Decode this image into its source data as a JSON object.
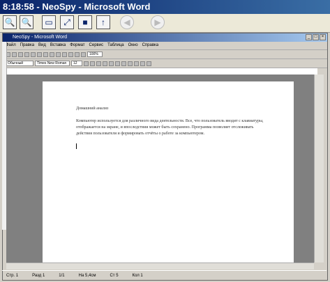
{
  "outer_window": {
    "title": "8:18:58 - NeoSpy - Microsoft Word"
  },
  "viewer_toolbar": {
    "buttons": [
      {
        "icon": "zoom-in-icon",
        "glyph": "🔍"
      },
      {
        "icon": "zoom-out-icon",
        "glyph": "🔍"
      },
      {
        "icon": "window-icon",
        "glyph": "▭"
      },
      {
        "icon": "fullscreen-icon",
        "glyph": "⤢"
      },
      {
        "icon": "stop-icon",
        "glyph": "■"
      },
      {
        "icon": "upload-icon",
        "glyph": "↑"
      },
      {
        "icon": "back-icon",
        "glyph": "◀"
      },
      {
        "icon": "forward-icon",
        "glyph": "▶"
      }
    ]
  },
  "word_window": {
    "title": "NeoSpy - Microsoft Word",
    "menu": [
      "Файл",
      "Правка",
      "Вид",
      "Вставка",
      "Формат",
      "Сервис",
      "Таблица",
      "Окно",
      "Справка"
    ],
    "format_bar": {
      "style": "Обычный",
      "font": "Times New Roman",
      "size": "12",
      "zoom": "100%"
    },
    "document": {
      "heading": "Домашний анализ",
      "paragraph": "Компьютер используется для различного вида деятельности. Все, что пользователь вводит с клавиатуры, отображается на экране, и впоследствии может быть сохранено. Программа позволяет отслеживать действия пользователя и формировать отчёты о работе за компьютером."
    },
    "status": {
      "page": "Стр. 1",
      "section": "Разд 1",
      "pages": "1/1",
      "at": "На 5,4см",
      "line": "Ст 5",
      "col": "Кол 1"
    }
  }
}
